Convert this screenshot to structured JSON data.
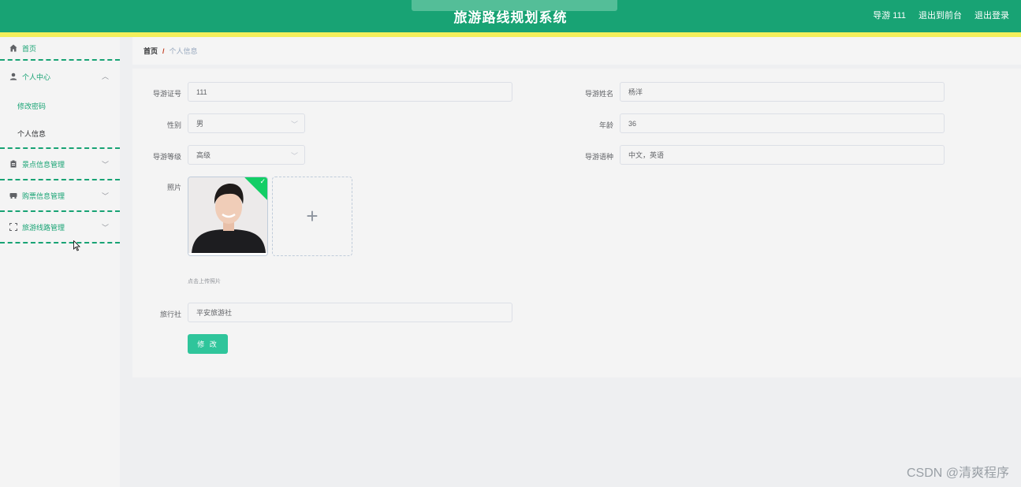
{
  "header": {
    "title": "旅游路线规划系统",
    "user": "导游 111",
    "exit_front": "退出到前台",
    "logout": "退出登录"
  },
  "sidebar": {
    "home": "首页",
    "personal_center": "个人中心",
    "change_password": "修改密码",
    "personal_info": "个人信息",
    "scenic_manage": "景点信息管理",
    "ticket_manage": "购票信息管理",
    "route_manage": "旅游线路管理"
  },
  "breadcrumb": {
    "home": "首页",
    "separator": "/",
    "current": "个人信息"
  },
  "form": {
    "guide_no_label": "导游证号",
    "guide_no": "111",
    "guide_name_label": "导游姓名",
    "guide_name": "杨洋",
    "gender_label": "性别",
    "gender": "男",
    "age_label": "年龄",
    "age": "36",
    "level_label": "导游等级",
    "level": "高级",
    "language_label": "导游语种",
    "language": "中文，英语",
    "photo_label": "照片",
    "upload_hint": "点击上传照片",
    "agency_label": "旅行社",
    "agency": "平安旅游社",
    "submit": "修 改"
  },
  "watermark": "CSDN @清爽程序",
  "colors": {
    "primary": "#18a374",
    "accent_bar": "#f3ef5b",
    "button": "#2fc59b"
  }
}
